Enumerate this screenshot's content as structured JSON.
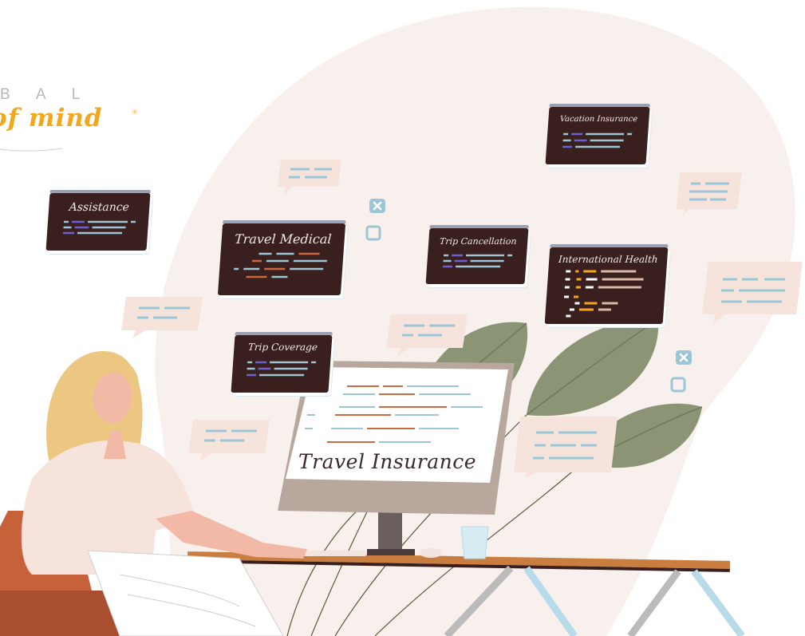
{
  "logo": {
    "top_text": "B A L",
    "script_text": "of mind",
    "registered_mark": "®"
  },
  "cards": {
    "assistance": "Assistance",
    "travel_medical": "Travel Medical",
    "trip_cancellation": "Trip Cancellation",
    "vacation_insurance": "Vacation Insurance",
    "international_health": "International Health",
    "trip_coverage": "Trip Coverage"
  },
  "monitor": {
    "title": "Travel Insurance"
  },
  "colors": {
    "card_bg": "#3a1f1f",
    "card_header": "#9aa1b2",
    "bubble": "#f6e4dc",
    "bubble_lines": "#9cc6d6",
    "blob": "#f8f0ec",
    "leaf": "#8b9474",
    "accent_orange": "#c96a3f",
    "accent_purple": "#6b5fd3",
    "accent_gold": "#f2a81d"
  },
  "icons": [
    "close-box-icon",
    "square-box-icon"
  ]
}
